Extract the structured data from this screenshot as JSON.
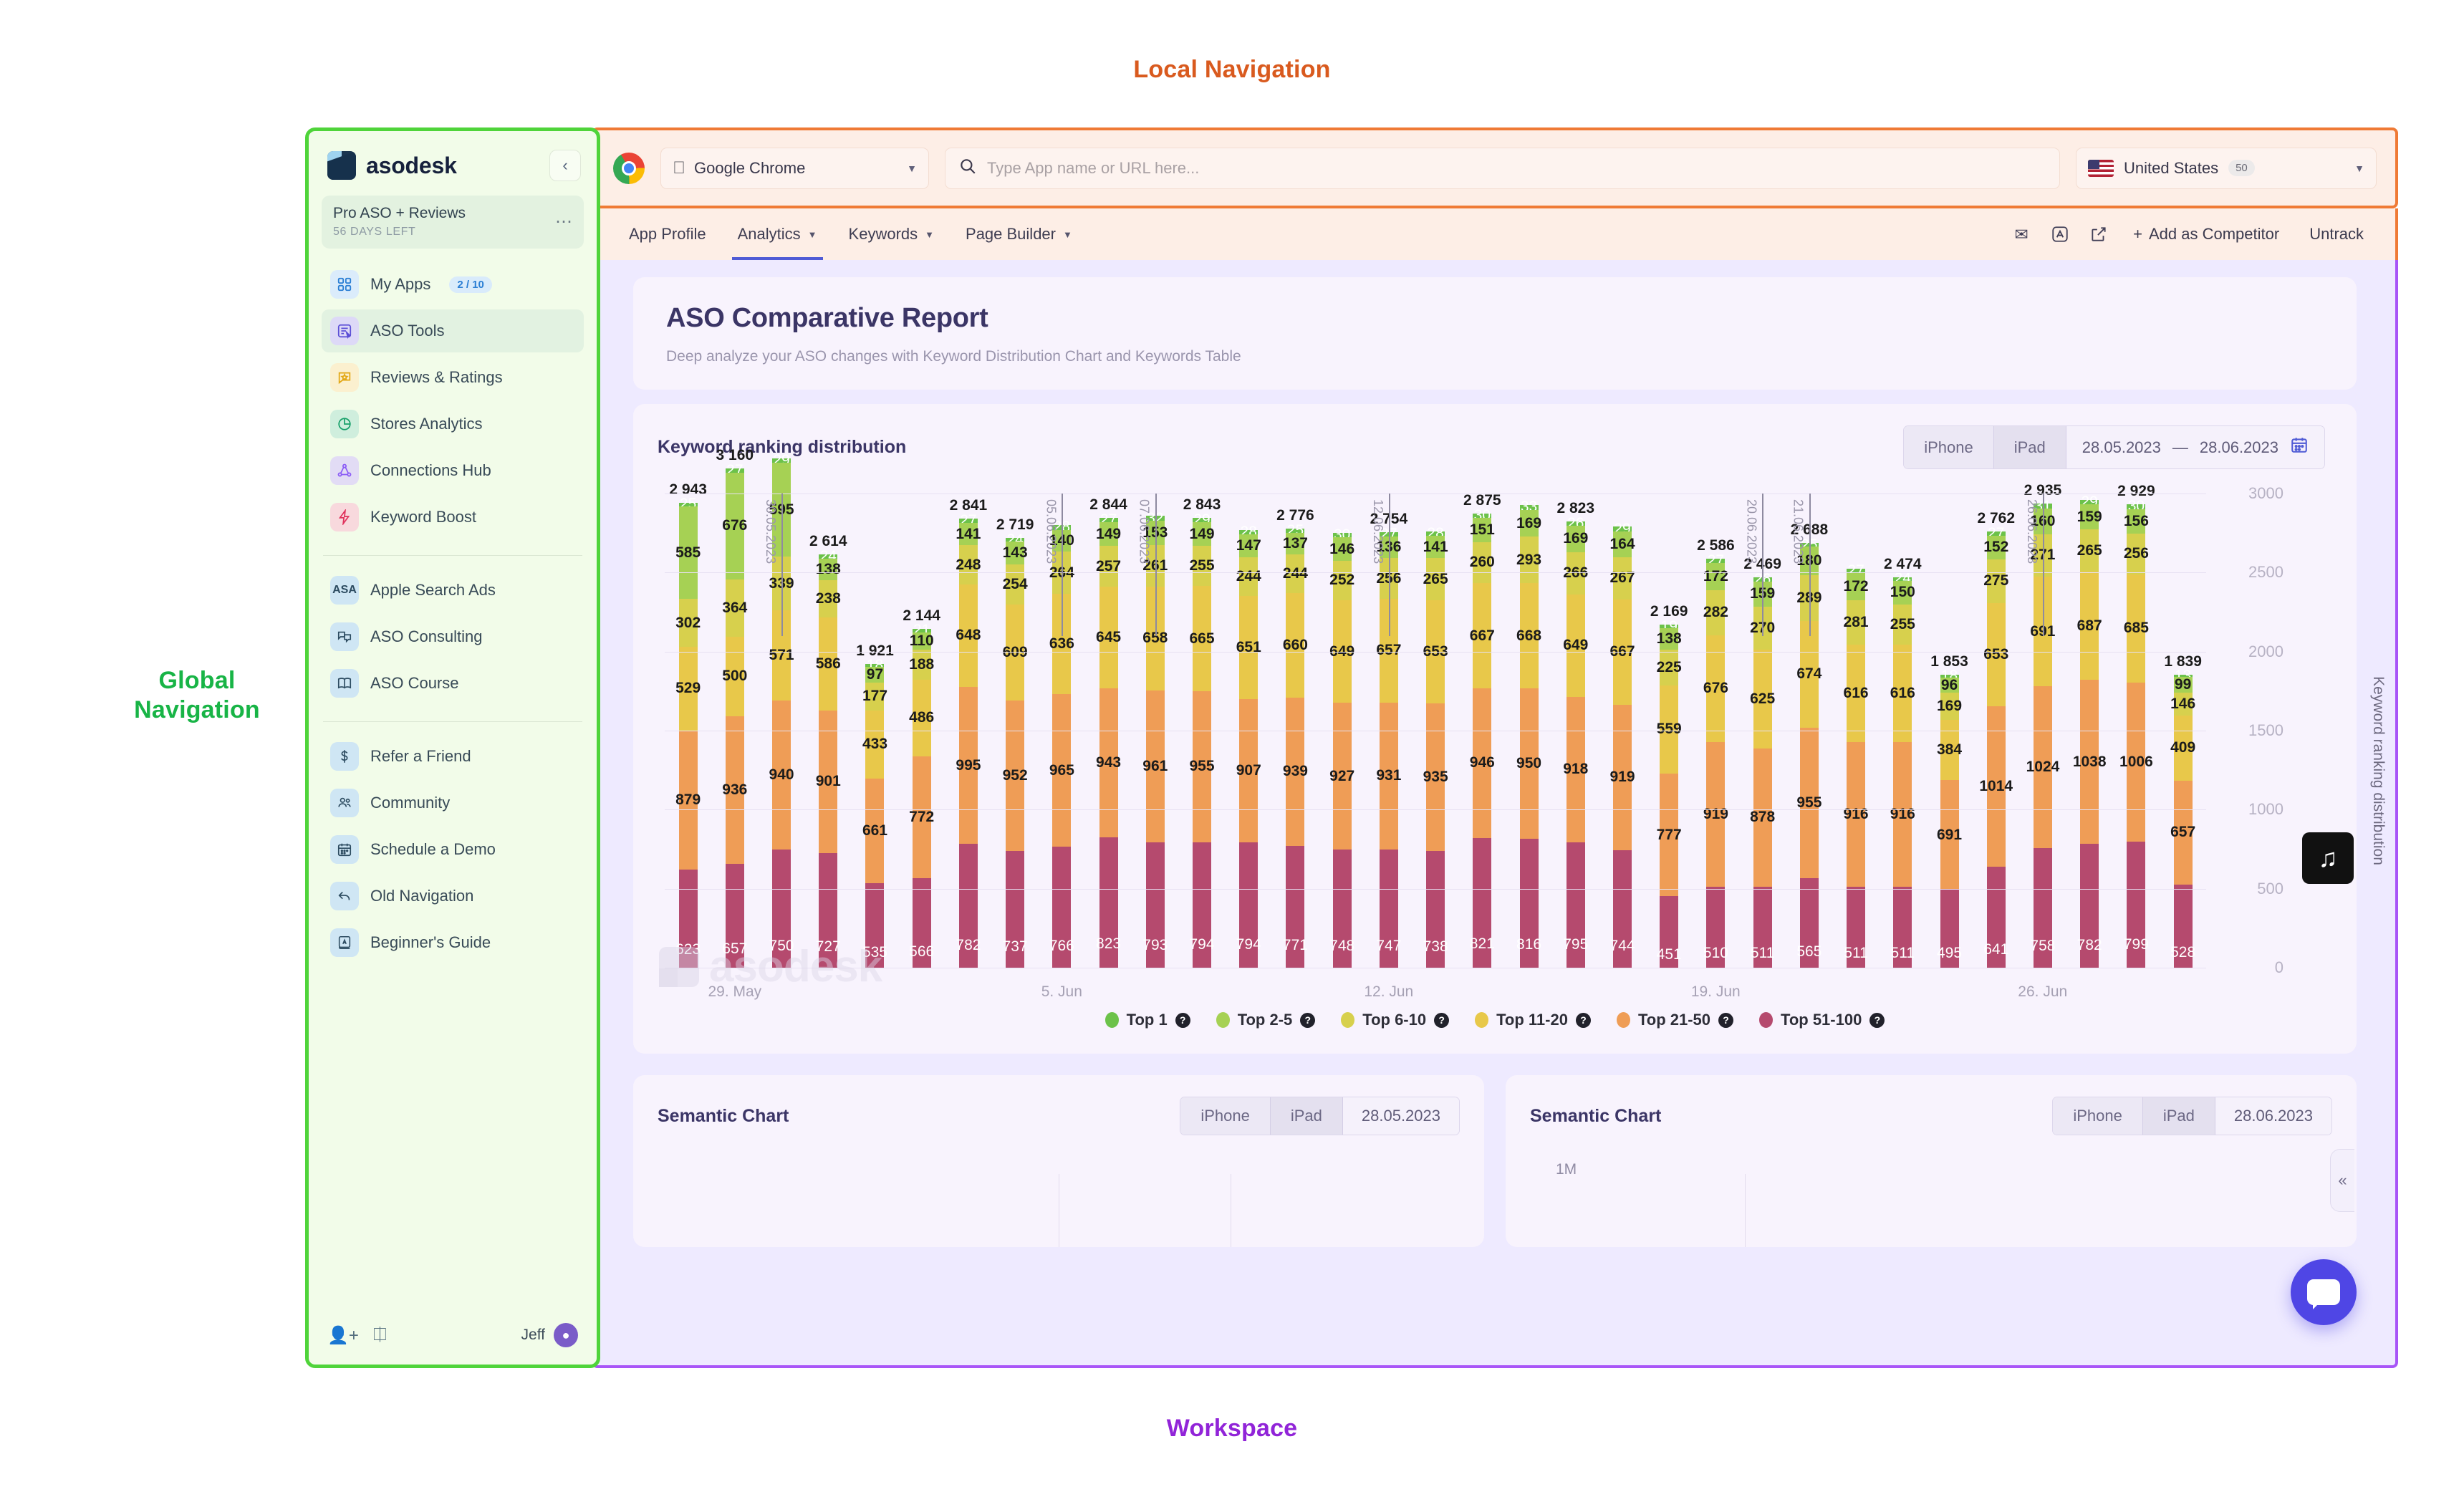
{
  "annotations": {
    "local_navigation": "Local Navigation",
    "global_navigation_line1": "Global",
    "global_navigation_line2": "Navigation",
    "workspace": "Workspace"
  },
  "sidebar": {
    "brand": "asodesk",
    "collapse_icon": "chevron-left-icon",
    "plan": {
      "name": "Pro ASO + Reviews",
      "days_left": "56 DAYS LEFT",
      "more_icon": "ellipsis-icon"
    },
    "primary_items": [
      {
        "label": "My Apps",
        "icon": "grid-icon",
        "badge": "2 / 10",
        "active": false
      },
      {
        "label": "ASO Tools",
        "icon": "document-cursor-icon",
        "badge": "",
        "active": true
      },
      {
        "label": "Reviews & Ratings",
        "icon": "star-comment-icon",
        "badge": "",
        "active": false
      },
      {
        "label": "Stores Analytics",
        "icon": "pie-chart-icon",
        "badge": "",
        "active": false
      },
      {
        "label": "Connections Hub",
        "icon": "share-nodes-icon",
        "badge": "",
        "active": false
      },
      {
        "label": "Keyword Boost",
        "icon": "bolt-icon",
        "badge": "",
        "active": false
      }
    ],
    "secondary_items": [
      {
        "label": "Apple Search Ads",
        "icon": "asa-icon"
      },
      {
        "label": "ASO Consulting",
        "icon": "chat-bubbles-icon"
      },
      {
        "label": "ASO Course",
        "icon": "book-icon"
      }
    ],
    "tertiary_items": [
      {
        "label": "Refer a Friend",
        "icon": "dollar-icon"
      },
      {
        "label": "Community",
        "icon": "people-icon"
      },
      {
        "label": "Schedule a Demo",
        "icon": "calendar-icon"
      },
      {
        "label": "Old Navigation",
        "icon": "undo-arrow-icon"
      },
      {
        "label": "Beginner's Guide",
        "icon": "guide-book-icon"
      }
    ],
    "footer": {
      "invite_icon": "add-user-icon",
      "help_icon": "help-icon",
      "user_name": "Jeff",
      "avatar_icon": "avatar-icon"
    }
  },
  "topbar": {
    "browser_icon": "chrome-icon",
    "app_platform_icon": "apple-icon",
    "app_name": "Google Chrome",
    "app_dropdown_icon": "chevron-down-icon",
    "search_icon": "search-icon",
    "search_value": "",
    "search_placeholder": "Type App name or URL here...",
    "country_flag_icon": "us-flag-icon",
    "country_name": "United States",
    "country_count": "50",
    "country_dropdown_icon": "chevron-down-icon"
  },
  "tabs": [
    {
      "label": "App Profile",
      "has_caret": false,
      "active": false
    },
    {
      "label": "Analytics",
      "has_caret": true,
      "active": true
    },
    {
      "label": "Keywords",
      "has_caret": true,
      "active": false
    },
    {
      "label": "Page Builder",
      "has_caret": true,
      "active": false
    }
  ],
  "nav_actions": {
    "icons": [
      {
        "name": "mail-icon",
        "glyph": "✉"
      },
      {
        "name": "app-store-icon",
        "glyph": "🅐"
      },
      {
        "name": "external-link-icon",
        "glyph": "↗"
      }
    ],
    "add_competitor": "Add as Competitor",
    "add_competitor_icon": "plus-icon",
    "untrack": "Untrack"
  },
  "report": {
    "title": "ASO Comparative Report",
    "subtitle": "Deep analyze your ASO changes with Keyword Distribution Chart and Keywords Table"
  },
  "chart_panel": {
    "title": "Keyword ranking distribution",
    "device_options": [
      "iPhone",
      "iPad"
    ],
    "device_selected": "iPhone",
    "date_from": "28.05.2023",
    "date_separator": "—",
    "date_to": "28.06.2023",
    "calendar_icon": "calendar-icon",
    "tiktok_icon": "tiktok-icon",
    "collapse_panel_icon": "chevron-double-left-icon",
    "watermark": "asodesk"
  },
  "semantic_cards": [
    {
      "title": "Semantic Chart",
      "device_options": [
        "iPhone",
        "iPad"
      ],
      "device_selected": "iPhone",
      "date": "28.05.2023",
      "range_label": ""
    },
    {
      "title": "Semantic Chart",
      "device_options": [
        "iPhone",
        "iPad"
      ],
      "device_selected": "iPhone",
      "date": "28.06.2023",
      "range_label": "1M"
    }
  ],
  "chat_widget": {
    "icon": "chat-bubble-icon"
  },
  "chart_data": {
    "type": "bar",
    "stacked": true,
    "title": "Keyword ranking distribution",
    "xlabel": "",
    "ylabel": "Keyword ranking distribution",
    "ylim": [
      0,
      3000
    ],
    "yticks": [
      0,
      500,
      1000,
      1500,
      2000,
      2500,
      3000
    ],
    "grid": true,
    "legend_position": "bottom",
    "legend": [
      {
        "name": "Top 1",
        "color": "#6cc24a"
      },
      {
        "name": "Top 2-5",
        "color": "#a6d154"
      },
      {
        "name": "Top 6-10",
        "color": "#d7d04d"
      },
      {
        "name": "Top 11-20",
        "color": "#e8c84a"
      },
      {
        "name": "Top 21-50",
        "color": "#ef9d56"
      },
      {
        "name": "Top 51-100",
        "color": "#b54a6e"
      }
    ],
    "series_order": [
      "Top 1",
      "Top 2-5",
      "Top 6-10",
      "Top 11-20",
      "Top 21-50",
      "Top 51-100"
    ],
    "xtick_labels": [
      "29. May",
      "5. Jun",
      "12. Jun",
      "19. Jun",
      "26. Jun"
    ],
    "xtick_indices": [
      1,
      8,
      15,
      22,
      29
    ],
    "vertical_markers": [
      {
        "index": 2,
        "label": "30.05.2023"
      },
      {
        "index": 8,
        "label": "05.06.2023"
      },
      {
        "index": 10,
        "label": "07.06.2023"
      },
      {
        "index": 15,
        "label": "12.06.2023"
      },
      {
        "index": 23,
        "label": "20.06.2023"
      },
      {
        "index": 24,
        "label": "21.06.2023"
      },
      {
        "index": 29,
        "label": "26.06.2023"
      }
    ],
    "bars": [
      {
        "total": "2 943",
        "segments": [
          "25",
          "585",
          "302",
          "529",
          "879",
          "623"
        ]
      },
      {
        "total": "3 160",
        "segments": [
          "27",
          "676",
          "364",
          "500",
          "936",
          "657"
        ]
      },
      {
        "total": "",
        "segments": [
          "29",
          "595",
          "339",
          "571",
          "940",
          "750"
        ]
      },
      {
        "total": "2 614",
        "segments": [
          "24",
          "138",
          "238",
          "586",
          "901",
          "727"
        ]
      },
      {
        "total": "1 921",
        "segments": [
          "18",
          "97",
          "177",
          "433",
          "661",
          "535"
        ]
      },
      {
        "total": "2 144",
        "segments": [
          "21",
          "110",
          "188",
          "486",
          "772",
          "566"
        ]
      },
      {
        "total": "2 841",
        "segments": [
          "27",
          "141",
          "248",
          "648",
          "995",
          "782"
        ]
      },
      {
        "total": "2 719",
        "segments": [
          "24",
          "143",
          "254",
          "609",
          "952",
          "737"
        ]
      },
      {
        "total": "",
        "segments": [
          "28",
          "140",
          "264",
          "636",
          "965",
          "766"
        ]
      },
      {
        "total": "2 844",
        "segments": [
          "27",
          "149",
          "257",
          "645",
          "943",
          "823"
        ]
      },
      {
        "total": "",
        "segments": [
          "32",
          "153",
          "261",
          "658",
          "961",
          "793"
        ]
      },
      {
        "total": "2 843",
        "segments": [
          "29",
          "149",
          "255",
          "665",
          "955",
          "794"
        ]
      },
      {
        "total": "",
        "segments": [
          "28",
          "147",
          "244",
          "651",
          "907",
          "794"
        ]
      },
      {
        "total": "2 776",
        "segments": [
          "25",
          "137",
          "244",
          "660",
          "939",
          "771"
        ]
      },
      {
        "total": "",
        "segments": [
          "30",
          "146",
          "252",
          "649",
          "927",
          "748"
        ]
      },
      {
        "total": "2 754",
        "segments": [
          "27",
          "136",
          "256",
          "657",
          "931",
          "747"
        ]
      },
      {
        "total": "",
        "segments": [
          "28",
          "141",
          "265",
          "653",
          "935",
          "738"
        ]
      },
      {
        "total": "2 875",
        "segments": [
          "30",
          "151",
          "260",
          "667",
          "946",
          "821"
        ]
      },
      {
        "total": "",
        "segments": [
          "33",
          "169",
          "293",
          "668",
          "950",
          "816"
        ]
      },
      {
        "total": "2 823",
        "segments": [
          "26",
          "169",
          "266",
          "649",
          "918",
          "795"
        ]
      },
      {
        "total": "",
        "segments": [
          "29",
          "164",
          "267",
          "667",
          "919",
          "744"
        ]
      },
      {
        "total": "2 169",
        "segments": [
          "19",
          "138",
          "225",
          "559",
          "777",
          "451"
        ]
      },
      {
        "total": "2 586",
        "segments": [
          "27",
          "172",
          "282",
          "676",
          "919",
          "510"
        ]
      },
      {
        "total": "2 469",
        "segments": [
          "26",
          "159",
          "270",
          "625",
          "878",
          "511"
        ]
      },
      {
        "total": "2 688",
        "segments": [
          "25",
          "180",
          "289",
          "674",
          "955",
          "565"
        ]
      },
      {
        "total": "",
        "segments": [
          "27",
          "172",
          "281",
          "616",
          "916",
          "511"
        ]
      },
      {
        "total": "2 474",
        "segments": [
          "24",
          "150",
          "255",
          "616",
          "916",
          "511"
        ]
      },
      {
        "total": "1 853",
        "segments": [
          "18",
          "96",
          "169",
          "384",
          "691",
          "495"
        ]
      },
      {
        "total": "2 762",
        "segments": [
          "27",
          "152",
          "275",
          "653",
          "1014",
          "641"
        ]
      },
      {
        "total": "2 935",
        "segments": [
          "31",
          "160",
          "271",
          "691",
          "1024",
          "758"
        ]
      },
      {
        "total": "",
        "segments": [
          "29",
          "159",
          "265",
          "687",
          "1038",
          "782"
        ]
      },
      {
        "total": "2 929",
        "segments": [
          "30",
          "156",
          "256",
          "685",
          "1006",
          "799"
        ]
      },
      {
        "total": "1 839",
        "segments": [
          "13",
          "99",
          "146",
          "409",
          "657",
          "528"
        ]
      }
    ]
  }
}
